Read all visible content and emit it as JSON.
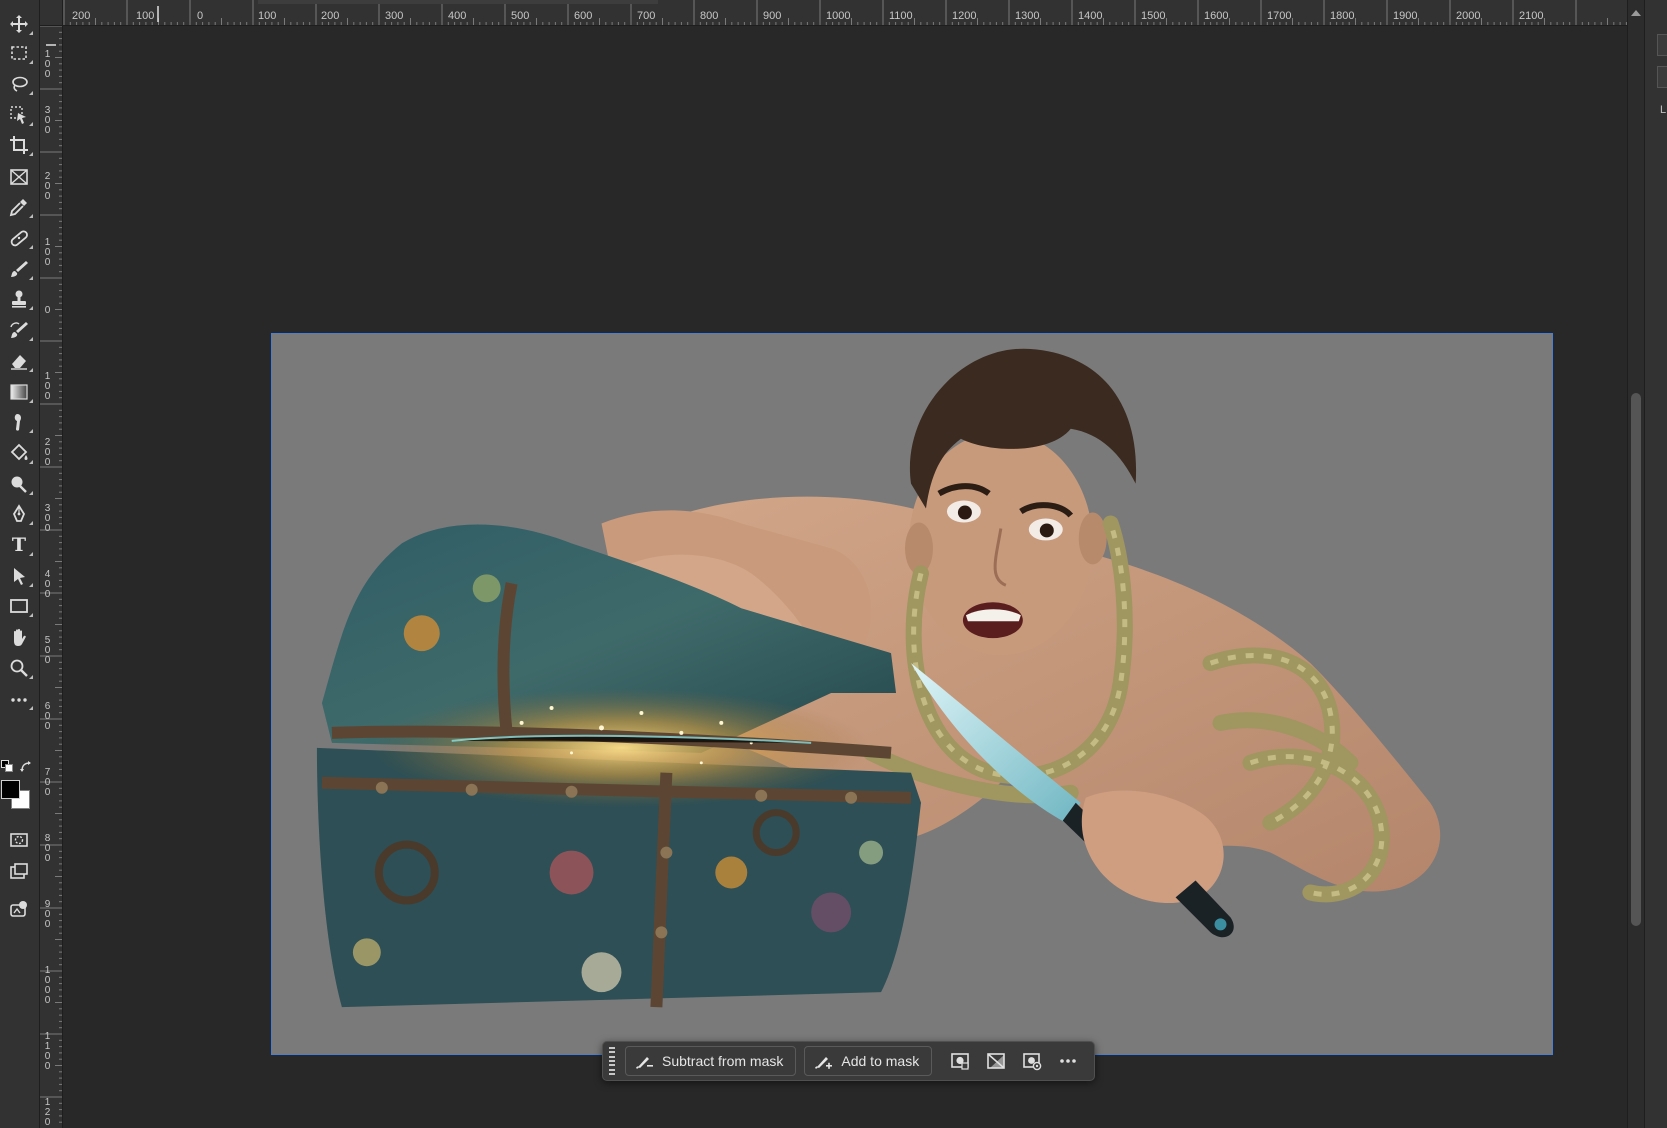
{
  "ruler": {
    "top_labels": [
      "200",
      "100",
      "0",
      "100",
      "200",
      "300",
      "400",
      "500",
      "600",
      "700",
      "800",
      "900",
      "1000",
      "1100",
      "1200",
      "1300",
      "1400",
      "1500",
      "1600",
      "1700",
      "1800",
      "1900",
      "2000",
      "2100"
    ],
    "left_labels": [
      "100",
      "300",
      "200",
      "100",
      "0",
      "100",
      "200",
      "300",
      "400",
      "500",
      "600",
      "700",
      "800",
      "900",
      "1000",
      "1100",
      "1200"
    ]
  },
  "toolbar": {
    "tools": [
      {
        "name": "move-tool",
        "icon": "move-icon"
      },
      {
        "name": "rectangular-marquee-tool",
        "icon": "marquee-icon"
      },
      {
        "name": "lasso-tool",
        "icon": "lasso-icon"
      },
      {
        "name": "object-selection-tool",
        "icon": "object-selection-icon"
      },
      {
        "name": "crop-tool",
        "icon": "crop-icon"
      },
      {
        "name": "frame-tool",
        "icon": "frame-icon"
      },
      {
        "name": "eyedropper-tool",
        "icon": "eyedropper-icon"
      },
      {
        "name": "spot-healing-tool",
        "icon": "bandage-icon"
      },
      {
        "name": "brush-tool",
        "icon": "brush-icon"
      },
      {
        "name": "clone-stamp-tool",
        "icon": "stamp-icon"
      },
      {
        "name": "history-brush-tool",
        "icon": "history-brush-icon"
      },
      {
        "name": "eraser-tool",
        "icon": "eraser-icon"
      },
      {
        "name": "gradient-tool",
        "icon": "gradient-icon"
      },
      {
        "name": "smudge-tool",
        "icon": "smudge-icon"
      },
      {
        "name": "paint-bucket-tool",
        "icon": "bucket-icon"
      },
      {
        "name": "dodge-tool",
        "icon": "dodge-icon"
      },
      {
        "name": "pen-tool",
        "icon": "pen-icon"
      },
      {
        "name": "type-tool",
        "icon": "type-icon"
      },
      {
        "name": "path-selection-tool",
        "icon": "arrow-icon"
      },
      {
        "name": "rectangle-tool",
        "icon": "rectangle-icon"
      },
      {
        "name": "hand-tool",
        "icon": "hand-icon"
      },
      {
        "name": "zoom-tool",
        "icon": "zoom-icon"
      },
      {
        "name": "edit-toolbar",
        "icon": "more-icon"
      }
    ],
    "type_tool_glyph": "T",
    "colors": {
      "foreground": "#000000",
      "background": "#ffffff"
    }
  },
  "canvas": {
    "background": "#7a7a7a",
    "border": "#4a7fd8"
  },
  "taskbar": {
    "subtract_label": "Subtract from mask",
    "add_label": "Add to mask",
    "icons": [
      "mask-options-icon",
      "invert-mask-icon",
      "mask-view-icon",
      "more-options-icon"
    ]
  },
  "colors": {
    "workspace": "#282828",
    "panel": "#323232",
    "accent": "#4a7fd8"
  }
}
